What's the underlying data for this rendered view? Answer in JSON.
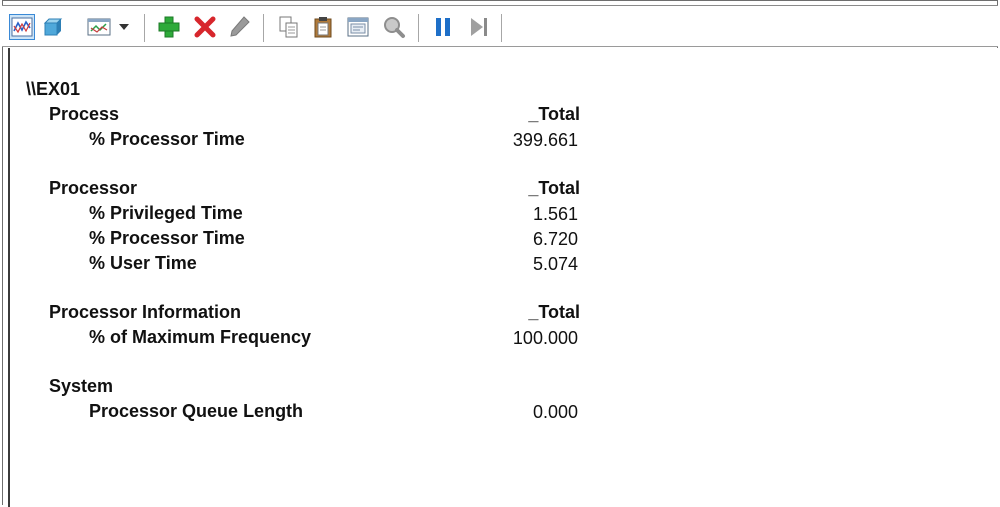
{
  "toolbar": {
    "buttons": [
      {
        "name": "view-graph-button",
        "icon": "graph-icon"
      },
      {
        "name": "view-histogram-button",
        "icon": "histogram-icon"
      },
      {
        "name": "change-graph-type-button",
        "icon": "report-icon"
      },
      {
        "name": "graph-type-dropdown",
        "icon": "chevron-down-icon"
      },
      {
        "name": "add-counter-button",
        "icon": "plus-icon"
      },
      {
        "name": "delete-counter-button",
        "icon": "close-icon"
      },
      {
        "name": "highlight-button",
        "icon": "pencil-icon"
      },
      {
        "name": "copy-properties-button",
        "icon": "copy-icon"
      },
      {
        "name": "paste-counter-list-button",
        "icon": "paste-icon"
      },
      {
        "name": "properties-button",
        "icon": "properties-icon"
      },
      {
        "name": "zoom-button",
        "icon": "magnifier-icon"
      },
      {
        "name": "freeze-display-button",
        "icon": "pause-icon"
      },
      {
        "name": "update-data-button",
        "icon": "step-icon"
      }
    ],
    "colors": {
      "green": "#2eaa3a",
      "red": "#d7262c",
      "blue": "#1e6fc8",
      "gray": "#9a9a9a"
    }
  },
  "report": {
    "computer": "\\\\EX01",
    "objects": [
      {
        "name": "Process",
        "instance": "_Total",
        "counters": [
          {
            "name": "% Processor Time",
            "value": "399.661"
          }
        ]
      },
      {
        "name": "Processor",
        "instance": "_Total",
        "counters": [
          {
            "name": "% Privileged Time",
            "value": "1.561"
          },
          {
            "name": "% Processor Time",
            "value": "6.720"
          },
          {
            "name": "% User Time",
            "value": "5.074"
          }
        ]
      },
      {
        "name": "Processor Information",
        "instance": "_Total",
        "counters": [
          {
            "name": "% of Maximum Frequency",
            "value": "100.000"
          }
        ]
      },
      {
        "name": "System",
        "instance": "",
        "counters": [
          {
            "name": "Processor Queue Length",
            "value": "0.000"
          }
        ]
      }
    ]
  }
}
